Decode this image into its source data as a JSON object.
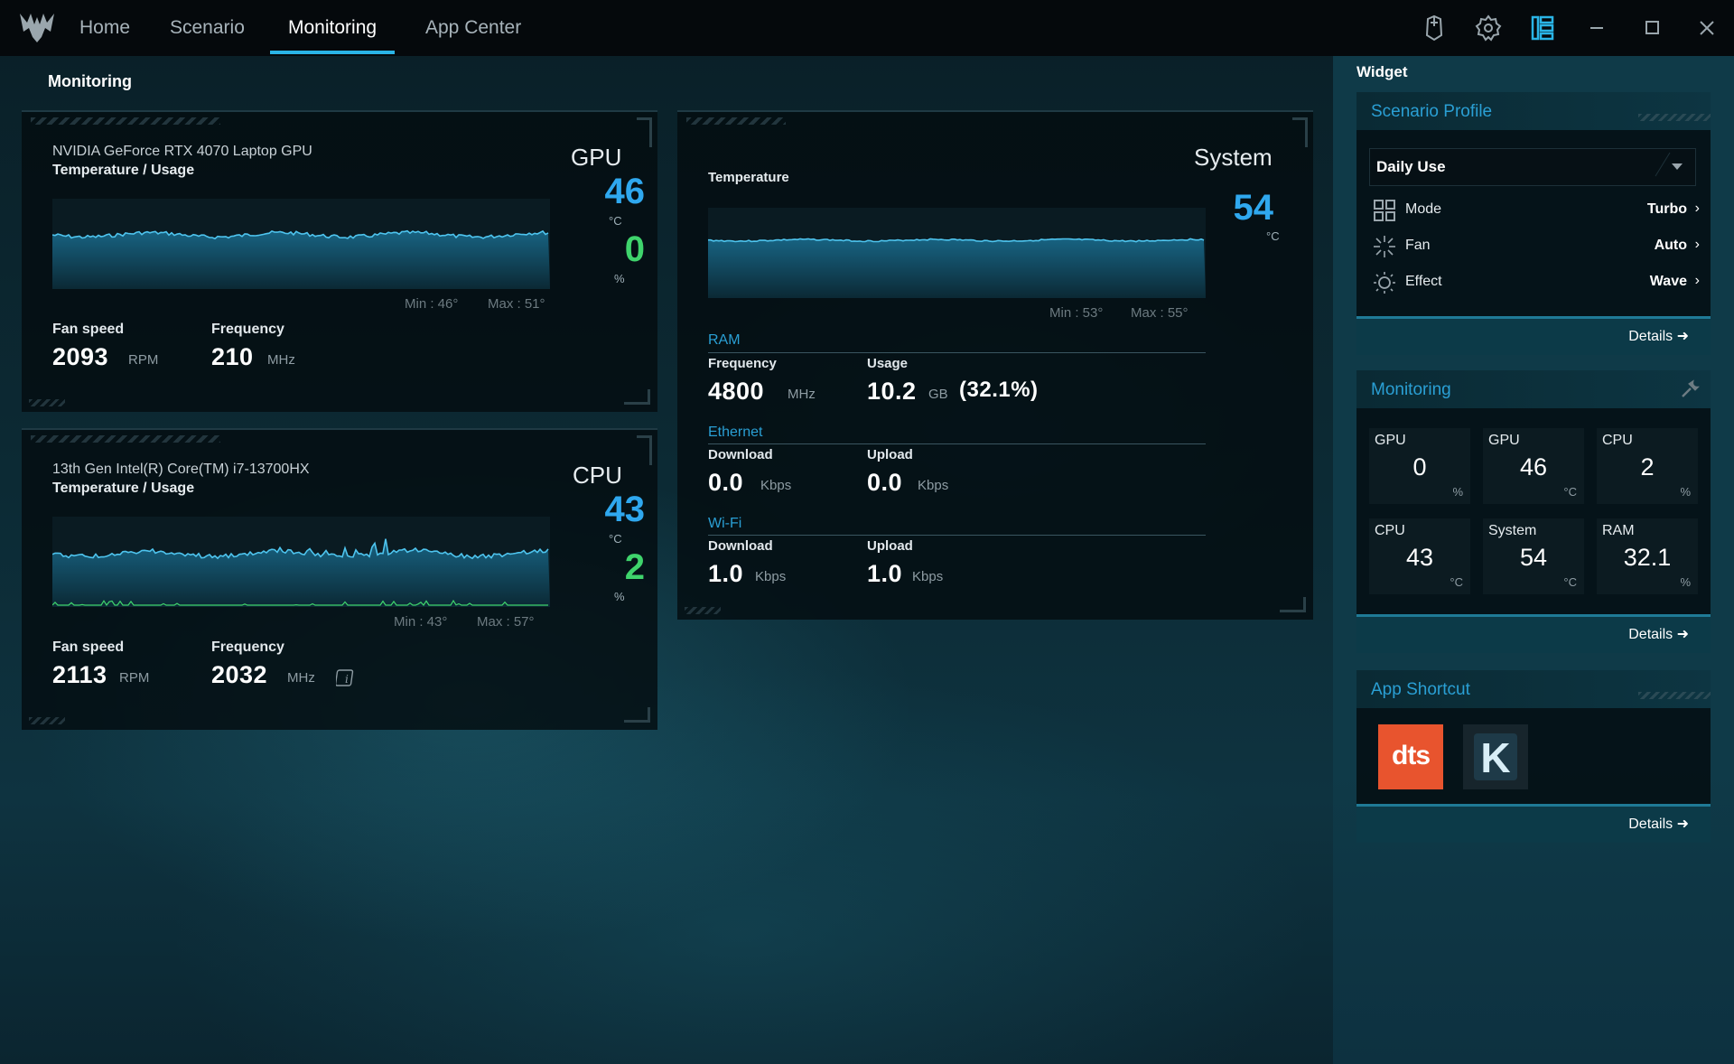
{
  "nav": {
    "tabs": [
      "Home",
      "Scenario",
      "Monitoring",
      "App Center"
    ],
    "active": "Monitoring"
  },
  "page_title": "Monitoring",
  "gpu": {
    "name": "NVIDIA GeForce RTX 4070 Laptop GPU",
    "sub": "Temperature / Usage",
    "label": "GPU",
    "temp": "46",
    "temp_unit": "°C",
    "usage": "0",
    "usage_unit": "%",
    "min": "Min : 46°",
    "max": "Max : 51°",
    "fan_label": "Fan speed",
    "fan_value": "2093",
    "fan_unit": "RPM",
    "freq_label": "Frequency",
    "freq_value": "210",
    "freq_unit": "MHz"
  },
  "cpu": {
    "name": "13th Gen Intel(R) Core(TM) i7-13700HX",
    "sub": "Temperature / Usage",
    "label": "CPU",
    "temp": "43",
    "temp_unit": "°C",
    "usage": "2",
    "usage_unit": "%",
    "min": "Min : 43°",
    "max": "Max : 57°",
    "fan_label": "Fan speed",
    "fan_value": "2113",
    "fan_unit": "RPM",
    "freq_label": "Frequency",
    "freq_value": "2032",
    "freq_unit": "MHz"
  },
  "system": {
    "label": "System",
    "temp_label": "Temperature",
    "temp": "54",
    "temp_unit": "°C",
    "min": "Min : 53°",
    "max": "Max : 55°",
    "ram": {
      "head": "RAM",
      "freq_label": "Frequency",
      "freq_value": "4800",
      "freq_unit": "MHz",
      "usage_label": "Usage",
      "usage_value": "10.2",
      "usage_unit": "GB",
      "usage_pct": "(32.1%)"
    },
    "ethernet": {
      "head": "Ethernet",
      "down_label": "Download",
      "down_value": "0.0",
      "down_unit": "Kbps",
      "up_label": "Upload",
      "up_value": "0.0",
      "up_unit": "Kbps"
    },
    "wifi": {
      "head": "Wi-Fi",
      "down_label": "Download",
      "down_value": "1.0",
      "down_unit": "Kbps",
      "up_label": "Upload",
      "up_value": "1.0",
      "up_unit": "Kbps"
    }
  },
  "sidebar": {
    "title": "Widget",
    "scenario": {
      "title": "Scenario Profile",
      "profile": "Daily Use",
      "rows": [
        {
          "label": "Mode",
          "value": "Turbo",
          "icon": "grid-icon"
        },
        {
          "label": "Fan",
          "value": "Auto",
          "icon": "fan-icon"
        },
        {
          "label": "Effect",
          "value": "Wave",
          "icon": "sun-icon"
        }
      ],
      "details": "Details"
    },
    "monitoring": {
      "title": "Monitoring",
      "tiles": [
        {
          "label": "GPU",
          "value": "0",
          "unit": "%"
        },
        {
          "label": "GPU",
          "value": "46",
          "unit": "°C"
        },
        {
          "label": "CPU",
          "value": "2",
          "unit": "%"
        },
        {
          "label": "CPU",
          "value": "43",
          "unit": "°C"
        },
        {
          "label": "System",
          "value": "54",
          "unit": "°C"
        },
        {
          "label": "RAM",
          "value": "32.1",
          "unit": "%"
        }
      ],
      "details": "Details"
    },
    "shortcuts": {
      "title": "App Shortcut",
      "apps": [
        {
          "name": "dts",
          "color": "#e8542e"
        },
        {
          "name": "K",
          "color": "#1e2b33"
        }
      ],
      "details": "Details"
    }
  },
  "colors": {
    "accent": "#2ab4e6",
    "temp": "#2fa8ef",
    "usage": "#3fd46c",
    "section": "#2a9fd4"
  }
}
